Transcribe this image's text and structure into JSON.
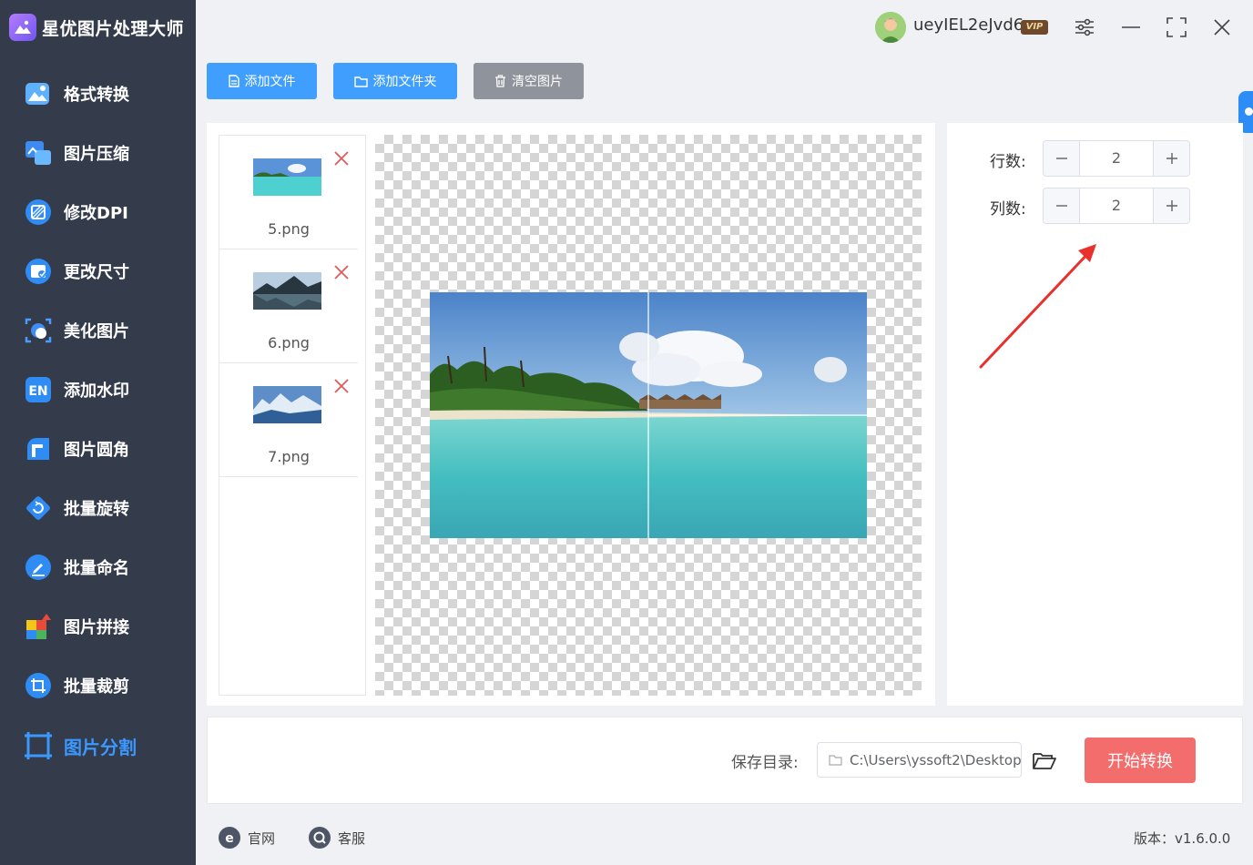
{
  "app": {
    "title": "星优图片处理大师"
  },
  "user": {
    "name": "ueyIEL2eJvd6",
    "badge": "VIP"
  },
  "sidebar": {
    "items": [
      {
        "label": "格式转换",
        "icon": "image-convert-icon"
      },
      {
        "label": "图片压缩",
        "icon": "image-compress-icon"
      },
      {
        "label": "修改DPI",
        "icon": "dpi-icon"
      },
      {
        "label": "更改尺寸",
        "icon": "resize-icon"
      },
      {
        "label": "美化图片",
        "icon": "beautify-icon"
      },
      {
        "label": "添加水印",
        "icon": "watermark-icon"
      },
      {
        "label": "图片圆角",
        "icon": "round-corner-icon"
      },
      {
        "label": "批量旋转",
        "icon": "rotate-icon"
      },
      {
        "label": "批量命名",
        "icon": "rename-icon"
      },
      {
        "label": "图片拼接",
        "icon": "puzzle-icon"
      },
      {
        "label": "批量裁剪",
        "icon": "crop-icon"
      },
      {
        "label": "图片分割",
        "icon": "split-icon",
        "active": true
      }
    ]
  },
  "toolbar": {
    "add_file": "添加文件",
    "add_folder": "添加文件夹",
    "clear": "清空图片"
  },
  "files": [
    {
      "name": "5.png",
      "thumb": "beach"
    },
    {
      "name": "6.png",
      "thumb": "lake-mountain"
    },
    {
      "name": "7.png",
      "thumb": "snow-mountain"
    }
  ],
  "settings": {
    "rows_label": "行数:",
    "rows_value": "2",
    "cols_label": "列数:",
    "cols_value": "2"
  },
  "output": {
    "save_label": "保存目录:",
    "save_path": "C:\\Users\\yssoft2\\Desktop",
    "start_button": "开始转换"
  },
  "footer": {
    "website": "官网",
    "support": "客服",
    "version": "版本：v1.6.0.0"
  },
  "colors": {
    "sidebar_bg": "#343b4b",
    "accent_blue": "#3a98ff",
    "primary_button": "#409eff",
    "clear_button": "#8f939b",
    "start_button": "#f36d6d",
    "annotation_arrow": "#e8302c"
  }
}
